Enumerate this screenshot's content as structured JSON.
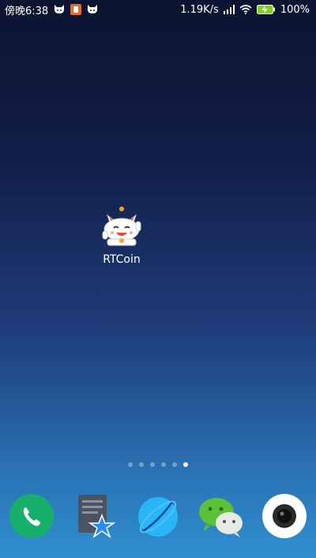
{
  "status_bar": {
    "time_label": "傍晚6:38",
    "network_speed": "1.19K/s",
    "battery_percent": "100%",
    "notification_icons": [
      "cat-icon",
      "media-icon",
      "cat-icon"
    ]
  },
  "home_screen": {
    "shortcut": {
      "label": "RTCoin",
      "icon": "lucky-cat-icon"
    },
    "page_indicator": {
      "pages": 6,
      "active_index": 5
    }
  },
  "dock": {
    "apps": [
      {
        "icon": "phone-icon",
        "color": "#16b06a"
      },
      {
        "icon": "file-manager-star-icon",
        "color": "#2a6fe0"
      },
      {
        "icon": "browser-icon",
        "color": "#29b6f6"
      },
      {
        "icon": "wechat-icon",
        "color": "#5bc236"
      },
      {
        "icon": "camera-icon",
        "color": "#ffffff"
      }
    ]
  }
}
